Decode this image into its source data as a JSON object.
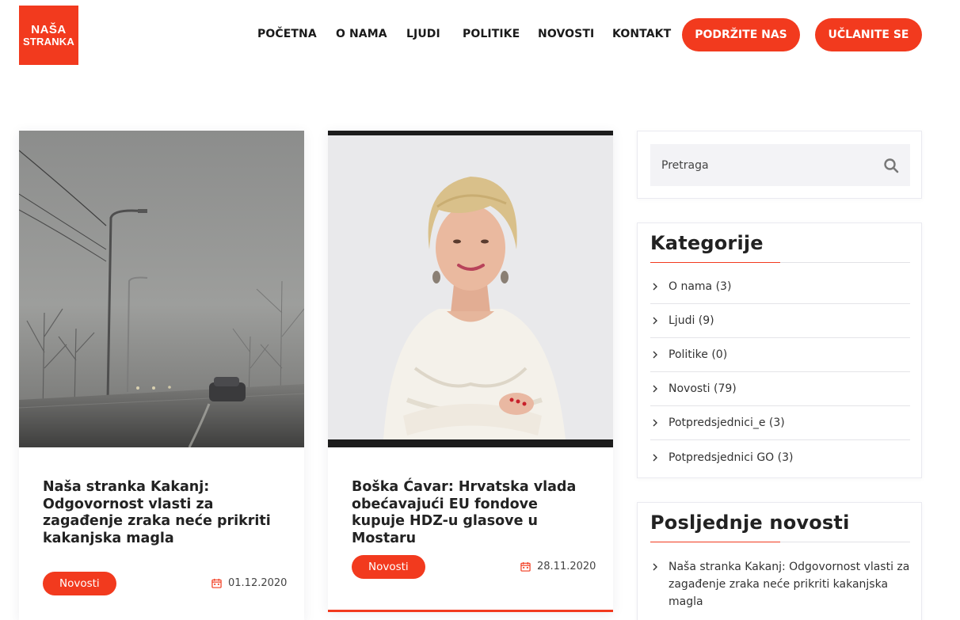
{
  "brand": {
    "line1": "NAŠA",
    "line2": "STRANKA",
    "color": "#f23a1e"
  },
  "nav": {
    "items": [
      "POČETNA",
      "O NAMA",
      "LJUDI",
      "POLITIKE",
      "NOVOSTI",
      "KONTAKT"
    ],
    "support_button": "PODRŽITE NAS",
    "join_button": "UČLANITE SE"
  },
  "posts": [
    {
      "title": "Naša stranka Kakanj: Odgovornost vlasti za zagađenje zraka neće prikriti kakanjska magla",
      "category": "Novosti",
      "date": "01.12.2020"
    },
    {
      "title": "Boška Ćavar: Hrvatska vlada obećavajući EU fondove kupuje HDZ-u glasove u Mostaru",
      "category": "Novosti",
      "date": "28.11.2020"
    }
  ],
  "sidebar": {
    "search": {
      "placeholder": "Pretraga"
    },
    "categories": {
      "title": "Kategorije",
      "items": [
        "O nama (3)",
        "Ljudi (9)",
        "Politike (0)",
        "Novosti (79)",
        "Potpredsjednici_e (3)",
        "Potpredsjednici GO (3)"
      ]
    },
    "latest": {
      "title": "Posljednje novosti",
      "items": [
        "Naša stranka Kakanj: Odgovornost vlasti za zagađenje zraka neće prikriti kakanjska magla"
      ]
    }
  }
}
